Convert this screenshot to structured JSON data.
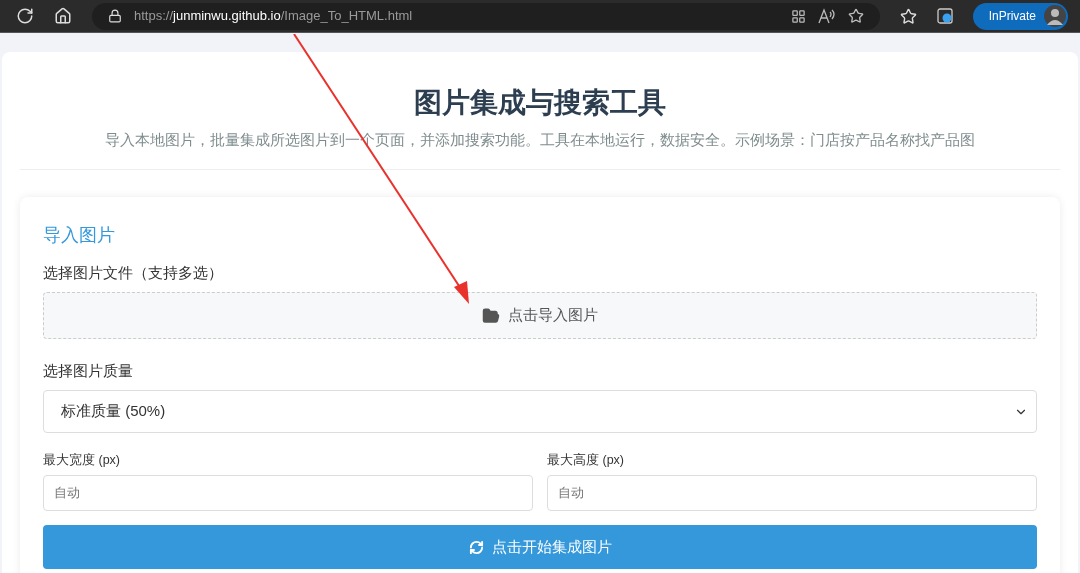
{
  "browser": {
    "url": {
      "scheme": "https://",
      "host": "junminwu.github.io",
      "path": "/Image_To_HTML.html"
    },
    "profile_label": "InPrivate"
  },
  "header": {
    "title": "图片集成与搜索工具",
    "subtitle": "导入本地图片，批量集成所选图片到一个页面，并添加搜索功能。工具在本地运行，数据安全。示例场景：门店按产品名称找产品图"
  },
  "import_section": {
    "heading": "导入图片",
    "file_label": "选择图片文件（支持多选）",
    "upload_button": "点击导入图片",
    "quality_label": "选择图片质量",
    "quality_value": "标准质量 (50%)",
    "width_field": {
      "label": "最大宽度 (px)",
      "placeholder": "自动"
    },
    "height_field": {
      "label": "最大高度 (px)",
      "placeholder": "自动"
    },
    "start_button": "点击开始集成图片"
  }
}
